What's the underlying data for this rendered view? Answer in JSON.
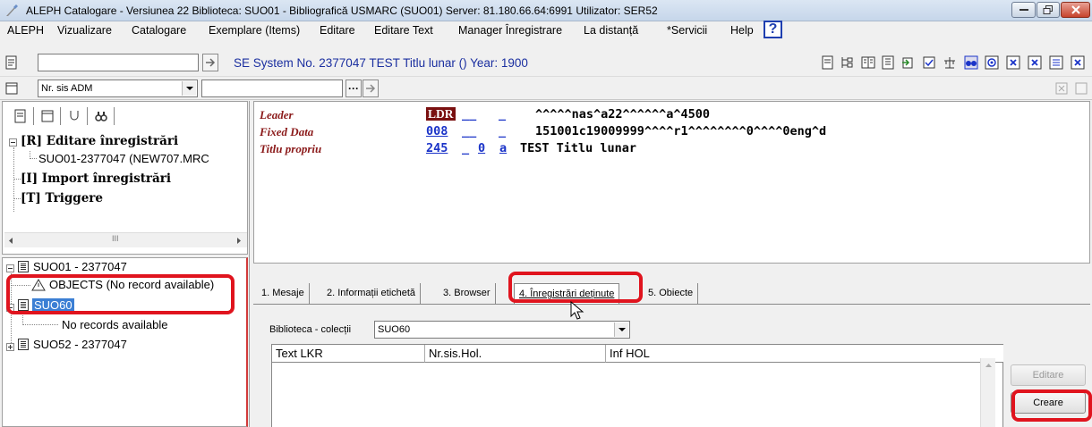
{
  "window": {
    "title": "ALEPH Catalogare - Versiunea 22  Biblioteca:  SUO01 - Bibliografică USMARC (SUO01)  Server:  81.180.66.64:6991  Utilizator:  SER52"
  },
  "menu": {
    "items": [
      "ALEPH",
      "Vizualizare",
      "Catalogare",
      "Exemplare (Items)",
      "Editare",
      "Editare Text",
      "Manager Înregistrare",
      "La distanță",
      "*Servicii",
      "Help"
    ],
    "help_glyph": "?"
  },
  "toolbar": {
    "system_label": "SE System No. 2377047 TEST Titlu lunar () Year: 1900",
    "search_index": "Nr. sis ADM",
    "search_value": "",
    "system_value": "",
    "ellipsis": "···"
  },
  "left_tree_top": {
    "items": [
      "[R] Editare înregistrări",
      "SUO01-2377047 (NEW707.MRC",
      "[I] Import înregistrări",
      "[T] Triggere"
    ],
    "scroll_thumb": "III"
  },
  "left_tree_bottom": {
    "root": "SUO01 - 2377047",
    "objects": "OBJECTS (No record available)",
    "suo60": "SUO60",
    "no_records": "No records available",
    "suo52": "SUO52 - 2377047"
  },
  "record": {
    "fields": [
      {
        "name": "Leader",
        "tag": "LDR",
        "ind1": "__",
        "ind2": "_",
        "sub": "",
        "content": "^^^^^nas^a22^^^^^^a^4500"
      },
      {
        "name": "Fixed Data",
        "tag": "008",
        "ind1": "__",
        "ind2": "_",
        "sub": "",
        "content": "151001c19009999^^^^r1^^^^^^^^0^^^^0eng^d"
      },
      {
        "name": "Titlu propriu",
        "tag": "245",
        "ind1": "_",
        "ind2": "0",
        "sub": "a",
        "content": "TEST Titlu lunar"
      }
    ]
  },
  "tabs": [
    "1. Mesaje",
    "2. Informații etichetă",
    "3. Browser",
    "4. Înregistrări deținute",
    "5. Obiecte"
  ],
  "holdings": {
    "library_label": "Biblioteca - colecții",
    "library_value": "SUO60",
    "columns": [
      "Text LKR",
      "Nr.sis.Hol.",
      "Inf HOL"
    ],
    "edit_button": "Editare",
    "create_button": "Creare"
  },
  "colors": {
    "highlight_red": "#e0141e",
    "selection_blue": "#3b7fd4",
    "tag_blue": "#1a33c8",
    "field_name_red": "#8b1a1a"
  }
}
